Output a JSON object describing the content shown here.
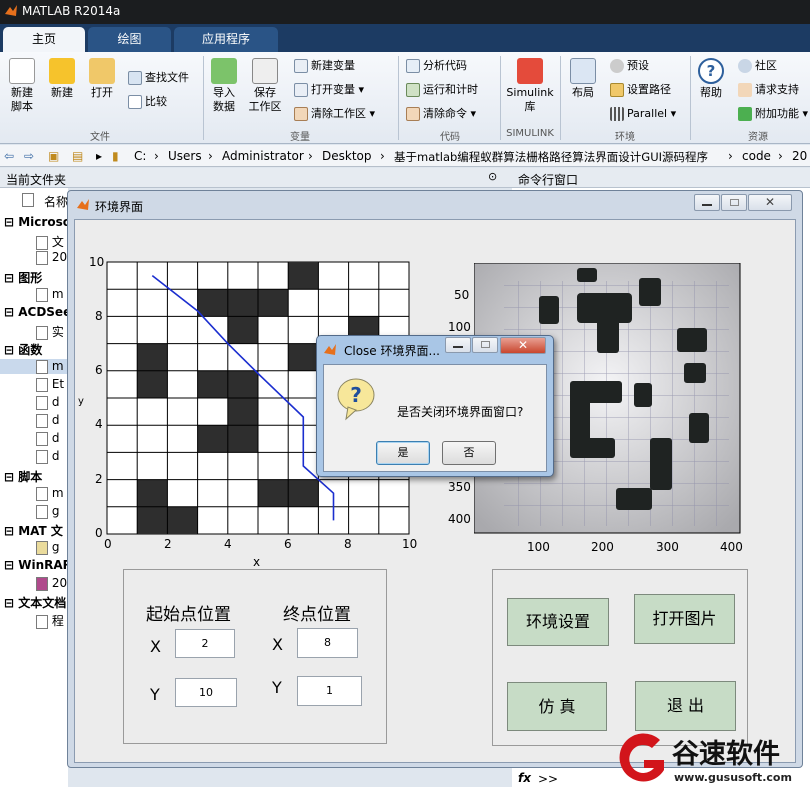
{
  "app": {
    "title": "MATLAB R2014a"
  },
  "tabs": [
    {
      "label": "主页"
    },
    {
      "label": "绘图"
    },
    {
      "label": "应用程序"
    }
  ],
  "ribbon": {
    "new_script": "新建\n脚本",
    "new": "新建",
    "open": "打开",
    "find_files": "查找文件",
    "compare": "比较",
    "import_data": "导入\n数据",
    "save_workspace": "保存\n工作区",
    "new_variable": "新建变量",
    "open_variable": "打开变量",
    "clear_workspace": "清除工作区",
    "analyze_code": "分析代码",
    "run_and_time": "运行和计时",
    "clear_commands": "清除命令",
    "simulink_lib": "Simulink\n库",
    "layout": "布局",
    "preferences": "预设",
    "set_path": "设置路径",
    "parallel": "Parallel",
    "help": "帮助",
    "community": "社区",
    "request_support": "请求支持",
    "addons": "附加功能",
    "groups": {
      "file": "文件",
      "variable": "变量",
      "code": "代码",
      "simulink": "SIMULINK",
      "environment": "环境",
      "resources": "资源"
    }
  },
  "address": {
    "crumbs": [
      "C:",
      "Users",
      "Administrator",
      "Desktop",
      "基于matlab编程蚁群算法栅格路径算法界面设计GUI源码程序",
      "code",
      "20"
    ]
  },
  "left_panel": {
    "header": "当前文件夹",
    "col_name": "名称",
    "tree": [
      "Microso",
      "文",
      "20",
      "图形",
      "m",
      "ACDSee",
      "实",
      "函数",
      "m",
      "Et",
      "d",
      "d",
      "d",
      "d",
      "脚本",
      "m",
      "g",
      "MAT 文",
      "g",
      "WinRAR",
      "20",
      "文本文档",
      "程"
    ]
  },
  "right_panel": {
    "header": "命令行窗口",
    "fx_prompt": ">>"
  },
  "figure": {
    "title": "环境界面",
    "grid_plot": {
      "x_ticks": [
        "0",
        "2",
        "4",
        "6",
        "8",
        "10"
      ],
      "y_ticks": [
        "0",
        "2",
        "4",
        "6",
        "8",
        "10"
      ],
      "xlabel": "x",
      "ylabel": "y"
    },
    "image_plot": {
      "x_ticks": [
        "100",
        "200",
        "300",
        "400"
      ],
      "y_ticks": [
        "50",
        "100",
        "150",
        "200",
        "250",
        "300",
        "350",
        "400"
      ]
    },
    "start_label": "起始点位置",
    "end_label": "终点位置",
    "x_label": "X",
    "y_label": "Y",
    "start_x": "2",
    "start_y": "10",
    "end_x": "8",
    "end_y": "1",
    "buttons": {
      "env_setup": "环境设置",
      "open_image": "打开图片",
      "simulate": "仿 真",
      "exit": "退 出"
    }
  },
  "dialog": {
    "title": "Close 环境界面...",
    "message": "是否关闭环境界面窗口?",
    "yes": "是",
    "no": "否"
  },
  "watermark": {
    "brand": "谷速软件",
    "url": "www.gususoft.com"
  },
  "chart_data": {
    "type": "heatmap",
    "grid": {
      "size": 10,
      "obstacles": [
        [
          6,
          0
        ],
        [
          3,
          1
        ],
        [
          4,
          1
        ],
        [
          5,
          1
        ],
        [
          4,
          2
        ],
        [
          8,
          2
        ],
        [
          1,
          3
        ],
        [
          6,
          3
        ],
        [
          1,
          4
        ],
        [
          3,
          4
        ],
        [
          4,
          4
        ],
        [
          4,
          5
        ],
        [
          3,
          6
        ],
        [
          4,
          6
        ],
        [
          1,
          8
        ],
        [
          5,
          8
        ],
        [
          6,
          8
        ],
        [
          1,
          9
        ],
        [
          2,
          9
        ]
      ]
    },
    "path": {
      "x": [
        1.5,
        3,
        4,
        5,
        6.5,
        6.5,
        7.5,
        7.5
      ],
      "y": [
        9.5,
        8.2,
        7,
        5.9,
        4.3,
        2.5,
        1.5,
        0.5
      ]
    },
    "xlim": [
      0,
      10
    ],
    "ylim": [
      0,
      10
    ]
  }
}
